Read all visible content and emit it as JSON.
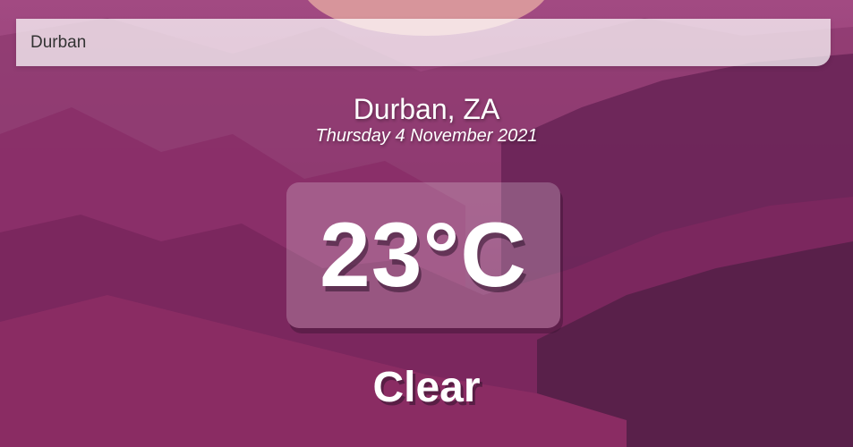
{
  "search": {
    "value": "Durban",
    "placeholder": ""
  },
  "location": {
    "city_country": "Durban, ZA",
    "date": "Thursday 4 November 2021"
  },
  "weather": {
    "temperature": "23°C",
    "condition": "Clear"
  },
  "colors": {
    "background_top": "#9b4a7c",
    "background_bottom": "#6b2456",
    "sun": "#e8b0a6"
  }
}
